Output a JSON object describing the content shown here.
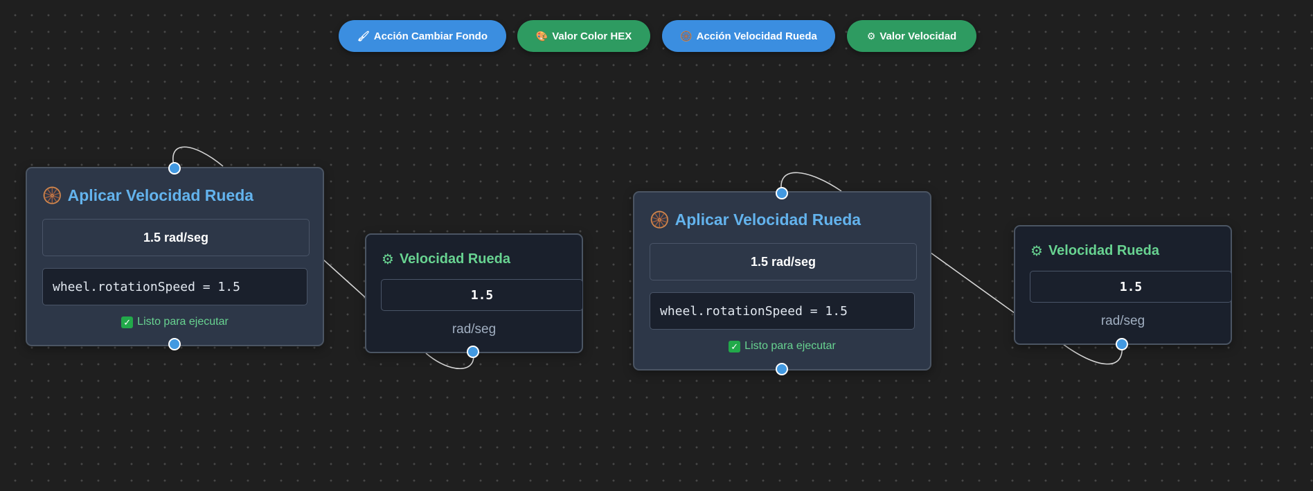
{
  "toolbar": {
    "buttons": [
      {
        "icon": "🖌",
        "icon_name": "paintbrush-icon",
        "label": "Acción Cambiar Fondo",
        "color": "#3b8ee0"
      },
      {
        "icon": "🎨",
        "icon_name": "palette-icon",
        "label": "Valor Color HEX",
        "color": "#2e9b61"
      },
      {
        "icon": "🛞",
        "icon_name": "wheel-icon",
        "label": "Acción Velocidad Rueda",
        "color": "#3b8ee0"
      },
      {
        "icon": "⚙",
        "icon_name": "gear-icon",
        "label": "Valor Velocidad",
        "color": "#2e9b61"
      }
    ]
  },
  "nodes": {
    "action_1": {
      "icon": "🛞",
      "title": "Aplicar Velocidad Rueda",
      "speed_label": "1.5 rad/seg",
      "code": "wheel.rotationSpeed = 1.5",
      "status_icon": "✓",
      "status": "Listo para ejecutar"
    },
    "value_1": {
      "icon": "⚙",
      "title": "Velocidad Rueda",
      "value": "1.5",
      "unit": "rad/seg"
    },
    "action_2": {
      "icon": "🛞",
      "title": "Aplicar Velocidad Rueda",
      "speed_label": "1.5 rad/seg",
      "code": "wheel.rotationSpeed = 1.5",
      "status_icon": "✓",
      "status": "Listo para ejecutar"
    },
    "value_2": {
      "icon": "⚙",
      "title": "Velocidad Rueda",
      "value": "1.5",
      "unit": "rad/seg"
    }
  },
  "colors": {
    "action_title": "#63b3ed",
    "value_title": "#68d391",
    "handle": "#4299e1",
    "canvas_bg": "#1f1f1f"
  }
}
